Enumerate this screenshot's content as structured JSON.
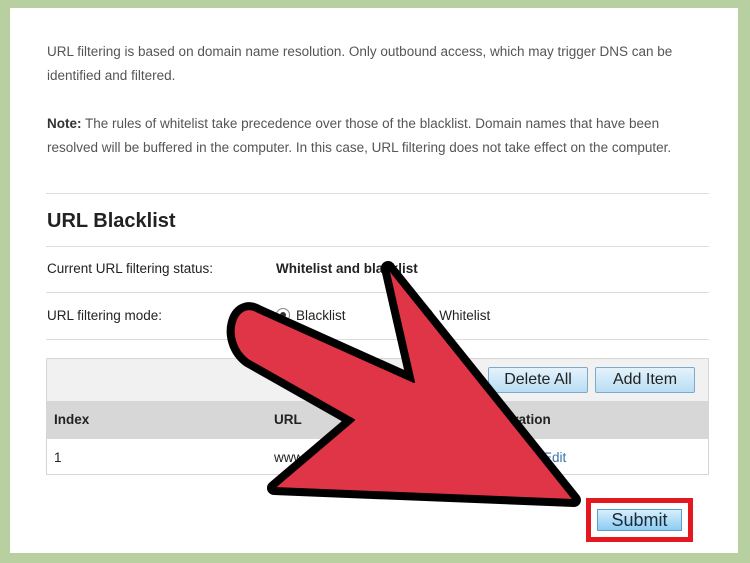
{
  "intro": {
    "paragraph1": "URL filtering is based on domain name resolution. Only outbound access, which may trigger DNS can be identified and filtered.",
    "note_label": "Note:",
    "note_text": " The rules of whitelist take precedence over those of the blacklist. Domain names that have been resolved will be buffered in the computer. In this case, URL filtering does not take effect on the computer."
  },
  "section": {
    "title": "URL Blacklist"
  },
  "status": {
    "label": "Current URL filtering status:",
    "value": "Whitelist and blacklist"
  },
  "mode": {
    "label": "URL filtering mode:",
    "option_blacklist": "Blacklist",
    "option_whitelist": "Whitelist",
    "selected": "Blacklist"
  },
  "toolbar": {
    "delete_all": "Delete All",
    "add_item": "Add Item"
  },
  "table": {
    "columns": [
      "Index",
      "URL",
      "Operation"
    ],
    "rows": [
      {
        "index": "1",
        "url": "www",
        "edit": "Edit"
      }
    ]
  },
  "submit": {
    "label": "Submit"
  },
  "colors": {
    "background": "#b8cf9f",
    "arrow_fill": "#e03447",
    "highlight": "#e3191f"
  }
}
